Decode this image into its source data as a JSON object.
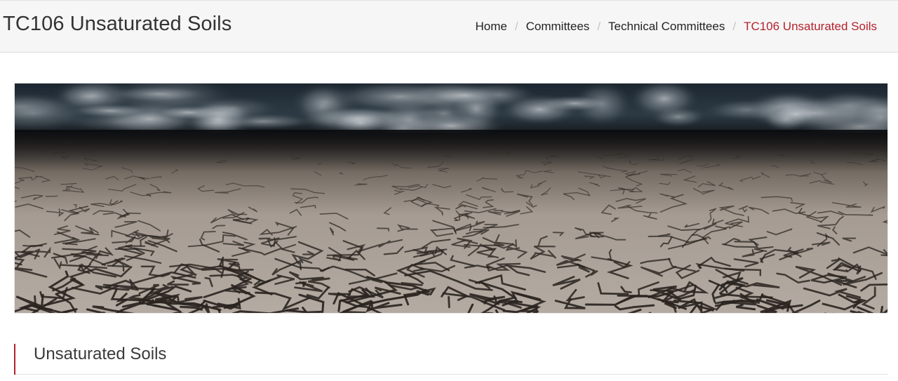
{
  "header": {
    "title": "TC106 Unsaturated Soils",
    "breadcrumb": [
      {
        "label": "Home",
        "active": false
      },
      {
        "label": "Committees",
        "active": false
      },
      {
        "label": "Technical Committees",
        "active": false
      },
      {
        "label": "TC106 Unsaturated Soils",
        "active": true
      }
    ],
    "separator": "/"
  },
  "banner": {
    "subject": "cracked dry earth under stormy clouds"
  },
  "section": {
    "title": "Unsaturated Soils"
  },
  "colors": {
    "accent": "#b5212e",
    "header_bg": "#f6f6f6",
    "text": "#333333"
  }
}
